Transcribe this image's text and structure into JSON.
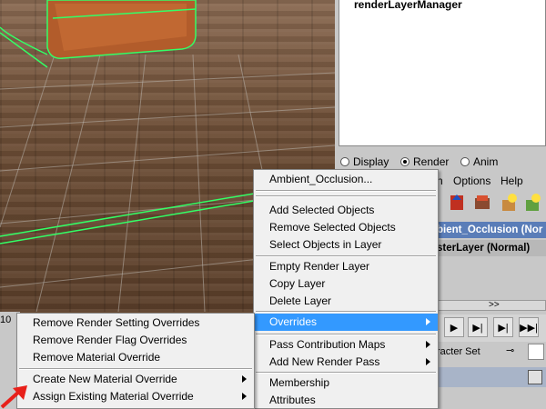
{
  "outliner": {
    "item": "renderLayerManager"
  },
  "radio": {
    "display": "Display",
    "render": "Render",
    "anim": "Anim",
    "selected": "render"
  },
  "layer_menubar": {
    "options": "Options",
    "help": "Help",
    "partial": "n"
  },
  "layers": {
    "selected": "bient_Occlusion (Nor",
    "base": "sterLayer (Normal)"
  },
  "scroll": {
    "label": ">>"
  },
  "charset": {
    "label": "racter Set"
  },
  "left_strip": {
    "value": "10"
  },
  "main_menu": {
    "header": "Ambient_Occlusion...",
    "items": [
      "Add Selected Objects",
      "Remove Selected Objects",
      "Select Objects in Layer",
      "Empty Render Layer",
      "Copy Layer",
      "Delete Layer",
      "Overrides",
      "Pass Contribution Maps",
      "Add New Render Pass",
      "Membership",
      "Attributes"
    ],
    "highlighted": "Overrides"
  },
  "sub_menu": {
    "items": [
      "Remove Render Setting Overrides",
      "Remove Render Flag Overrides",
      "Remove Material Override",
      "Create New Material Override",
      "Assign Existing Material Override"
    ]
  },
  "colors": {
    "highlight": "#3399ff",
    "wireframe": "#33ff66",
    "arrow": "#e8201a",
    "layer_selected": "#5a7db8"
  }
}
